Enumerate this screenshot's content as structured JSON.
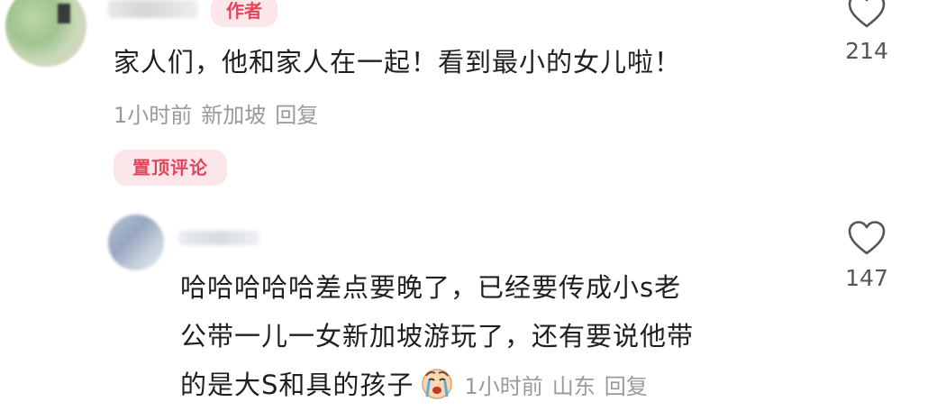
{
  "comments": [
    {
      "badge": "作者",
      "text": "家人们，他和家人在一起！看到最小的女儿啦！",
      "time": "1小时前",
      "location": "新加坡",
      "reply_label": "回复",
      "likes": "214",
      "pinned_label": "置顶评论"
    }
  ],
  "reply": {
    "lines": [
      "哈哈哈哈哈差点要晚了，已经要传成小s老",
      "公带一儿一女新加坡游玩了，还有要说他带",
      "的是大S和具的孩子"
    ],
    "time": "1小时前",
    "location": "山东",
    "reply_label": "回复",
    "likes": "147"
  },
  "icons": {
    "like": "heart-outline-icon",
    "emoji": "crying-face-emoji"
  },
  "colors": {
    "badge_bg": "#fde6ea",
    "badge_text": "#e0465b",
    "meta_text": "#9a9a9a"
  }
}
